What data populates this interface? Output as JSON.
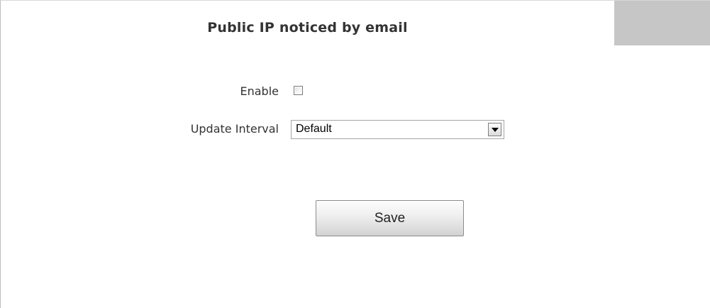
{
  "header": {
    "title": "Public IP noticed by email"
  },
  "form": {
    "enable": {
      "label": "Enable",
      "checked": false
    },
    "update_interval": {
      "label": "Update Interval",
      "selected": "Default"
    },
    "save_label": "Save"
  },
  "icons": {
    "dropdown": "chevron-down-icon"
  },
  "colors": {
    "title_text": "#333333",
    "corner_tab": "#c6c6c6",
    "panel_border": "#bdbdbd"
  }
}
